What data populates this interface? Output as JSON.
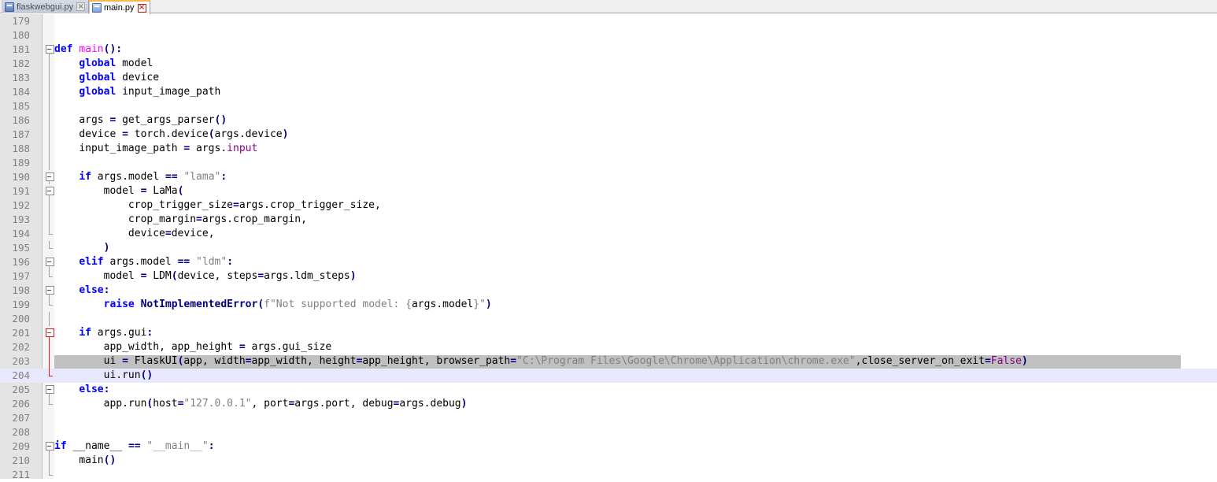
{
  "tabs": [
    {
      "label": "flaskwebgui.py",
      "active": false,
      "icon": "file-saved-icon"
    },
    {
      "label": "main.py",
      "active": true,
      "icon": "file-saved-icon"
    }
  ],
  "colors": {
    "keyword": "#0000ff",
    "function_name": "#ff00ff",
    "string": "#808080",
    "operator": "#000080",
    "builtin_attr": "#880088",
    "current_line": "#e8e8ff",
    "selection": "#c0c0c0"
  },
  "lines": [
    {
      "n": "179",
      "text": ""
    },
    {
      "n": "180",
      "text": ""
    },
    {
      "n": "181",
      "text": "def main():"
    },
    {
      "n": "182",
      "text": "    global model"
    },
    {
      "n": "183",
      "text": "    global device"
    },
    {
      "n": "184",
      "text": "    global input_image_path"
    },
    {
      "n": "185",
      "text": ""
    },
    {
      "n": "186",
      "text": "    args = get_args_parser()"
    },
    {
      "n": "187",
      "text": "    device = torch.device(args.device)"
    },
    {
      "n": "188",
      "text": "    input_image_path = args.input"
    },
    {
      "n": "189",
      "text": ""
    },
    {
      "n": "190",
      "text": "    if args.model == \"lama\":"
    },
    {
      "n": "191",
      "text": "        model = LaMa("
    },
    {
      "n": "192",
      "text": "            crop_trigger_size=args.crop_trigger_size,"
    },
    {
      "n": "193",
      "text": "            crop_margin=args.crop_margin,"
    },
    {
      "n": "194",
      "text": "            device=device,"
    },
    {
      "n": "195",
      "text": "        )"
    },
    {
      "n": "196",
      "text": "    elif args.model == \"ldm\":"
    },
    {
      "n": "197",
      "text": "        model = LDM(device, steps=args.ldm_steps)"
    },
    {
      "n": "198",
      "text": "    else:"
    },
    {
      "n": "199",
      "text": "        raise NotImplementedError(f\"Not supported model: {args.model}\")"
    },
    {
      "n": "200",
      "text": ""
    },
    {
      "n": "201",
      "text": "    if args.gui:"
    },
    {
      "n": "202",
      "text": "        app_width, app_height = args.gui_size"
    },
    {
      "n": "203",
      "text": "        ui = FlaskUI(app, width=app_width, height=app_height, browser_path=\"C:\\Program Files\\Google\\Chrome\\Application\\chrome.exe\",close_server_on_exit=False)"
    },
    {
      "n": "204",
      "text": "        ui.run()"
    },
    {
      "n": "205",
      "text": "    else:"
    },
    {
      "n": "206",
      "text": "        app.run(host=\"127.0.0.1\", port=args.port, debug=args.debug)"
    },
    {
      "n": "207",
      "text": ""
    },
    {
      "n": "208",
      "text": ""
    },
    {
      "n": "209",
      "text": "if __name__ == \"__main__\":"
    },
    {
      "n": "210",
      "text": "    main()"
    },
    {
      "n": "211",
      "text": ""
    }
  ]
}
